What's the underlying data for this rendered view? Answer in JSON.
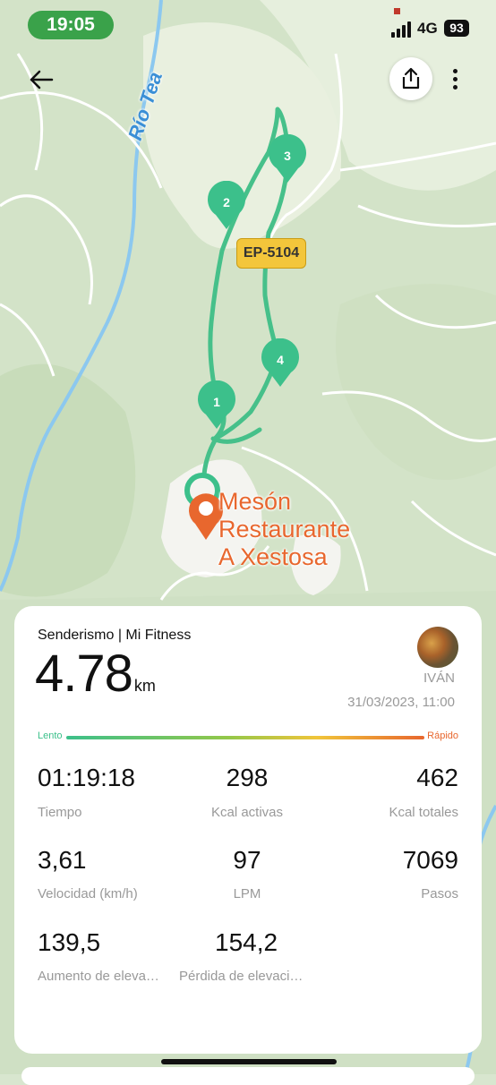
{
  "status": {
    "time": "19:05",
    "network": "4G",
    "battery": "93"
  },
  "map": {
    "river_label": "Río Tea",
    "road_badge": "EP-5104",
    "place_label": [
      "Mesón",
      "Restaurante",
      "A Xestosa"
    ],
    "markers": [
      "1",
      "2",
      "3",
      "4"
    ],
    "route_color": "#3cc08b",
    "place_color": "#e8672e"
  },
  "icons": {
    "back": "back-arrow-icon",
    "share": "share-icon",
    "more": "more-vertical-icon"
  },
  "activity": {
    "title": "Senderismo | Mi Fitness",
    "distance": "4.78",
    "distance_unit": "km",
    "user": "IVÁN",
    "date": "31/03/2023, 11:00",
    "speed_scale": {
      "slow": "Lento",
      "fast": "Rápido"
    },
    "stats": [
      {
        "value": "01:19:18",
        "label": "Tiempo"
      },
      {
        "value": "298",
        "label": "Kcal activas"
      },
      {
        "value": "462",
        "label": "Kcal totales"
      },
      {
        "value": "3,61",
        "label": "Velocidad (km/h)"
      },
      {
        "value": "97",
        "label": "LPM"
      },
      {
        "value": "7069",
        "label": "Pasos"
      },
      {
        "value": "139,5",
        "label": "Aumento de eleva…"
      },
      {
        "value": "154,2",
        "label": "Pérdida de elevaci…"
      }
    ]
  }
}
